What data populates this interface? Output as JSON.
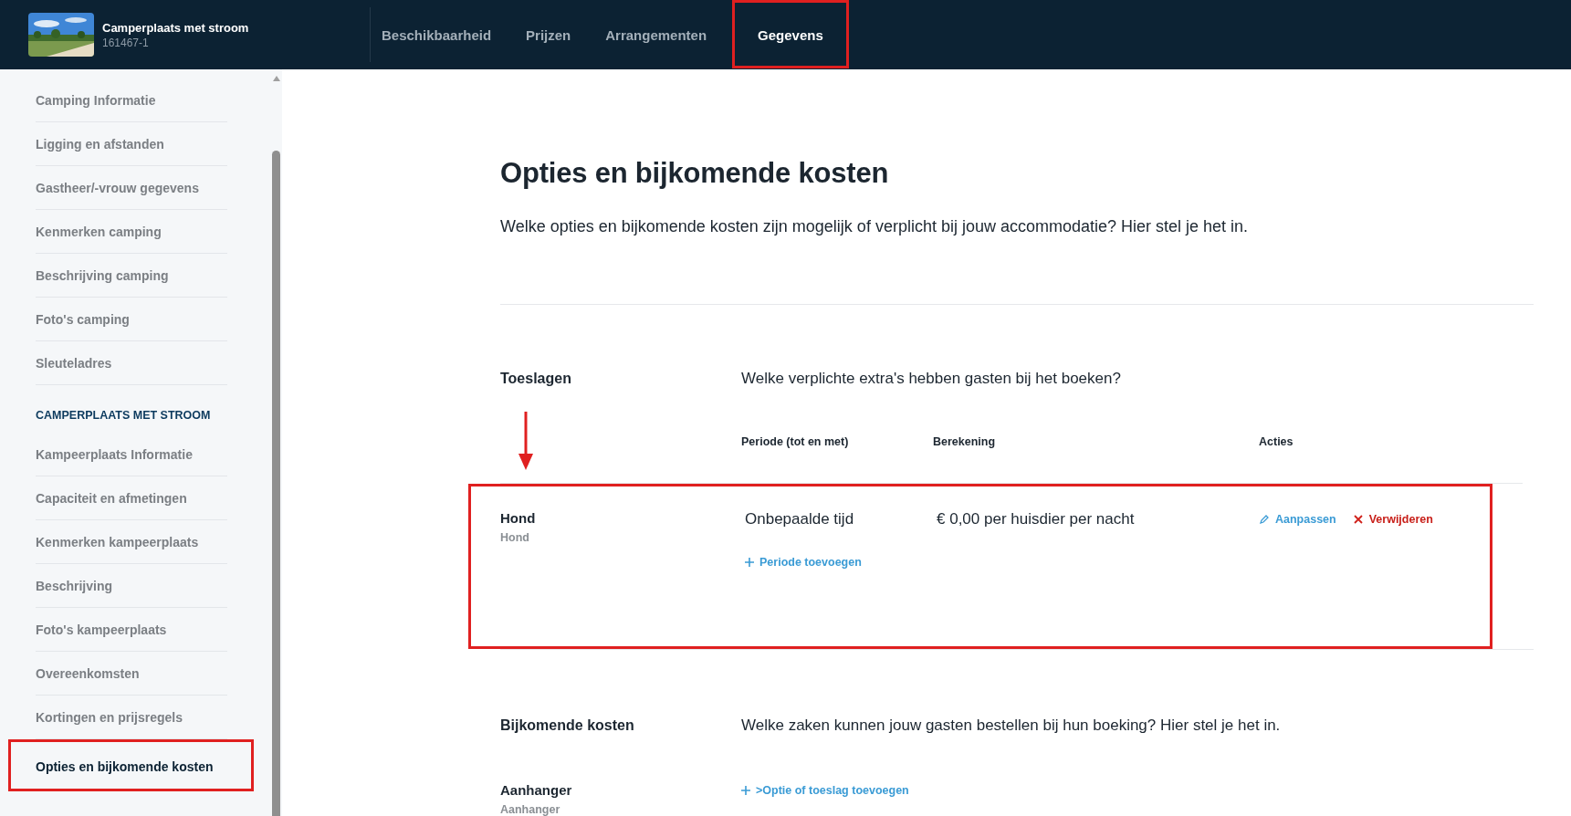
{
  "header": {
    "title": "Camperplaats met stroom",
    "code": "161467-1"
  },
  "tabs": [
    {
      "label": "Beschikbaarheid",
      "selected": false,
      "highlighted": false
    },
    {
      "label": "Prijzen",
      "selected": false,
      "highlighted": false
    },
    {
      "label": "Arrangementen",
      "selected": false,
      "highlighted": false
    },
    {
      "label": "Gegevens",
      "selected": true,
      "highlighted": true
    }
  ],
  "sidebar": {
    "items": [
      {
        "kind": "link",
        "label": "Camping Informatie",
        "selected": false,
        "highlighted": false
      },
      {
        "kind": "link",
        "label": "Ligging en afstanden",
        "selected": false,
        "highlighted": false
      },
      {
        "kind": "link",
        "label": "Gastheer/-vrouw gegevens",
        "selected": false,
        "highlighted": false
      },
      {
        "kind": "link",
        "label": "Kenmerken camping",
        "selected": false,
        "highlighted": false
      },
      {
        "kind": "link",
        "label": "Beschrijving camping",
        "selected": false,
        "highlighted": false
      },
      {
        "kind": "link",
        "label": "Foto's camping",
        "selected": false,
        "highlighted": false
      },
      {
        "kind": "link",
        "label": "Sleuteladres",
        "selected": false,
        "highlighted": false
      },
      {
        "kind": "heading",
        "label": "CAMPERPLAATS MET STROOM"
      },
      {
        "kind": "link",
        "label": "Kampeerplaats Informatie",
        "selected": false,
        "highlighted": false
      },
      {
        "kind": "link",
        "label": "Capaciteit en afmetingen",
        "selected": false,
        "highlighted": false
      },
      {
        "kind": "link",
        "label": "Kenmerken kampeerplaats",
        "selected": false,
        "highlighted": false
      },
      {
        "kind": "link",
        "label": "Beschrijving",
        "selected": false,
        "highlighted": false
      },
      {
        "kind": "link",
        "label": "Foto's kampeerplaats",
        "selected": false,
        "highlighted": false
      },
      {
        "kind": "link",
        "label": "Overeenkomsten",
        "selected": false,
        "highlighted": false
      },
      {
        "kind": "link",
        "label": "Kortingen en prijsregels",
        "selected": false,
        "highlighted": false
      },
      {
        "kind": "link",
        "label": "Opties en bijkomende kosten",
        "selected": true,
        "highlighted": true
      }
    ]
  },
  "page": {
    "title": "Opties en bijkomende kosten",
    "description": "Welke opties en bijkomende kosten zijn mogelijk of verplicht bij jouw accommodatie? Hier stel je het in."
  },
  "surcharges": {
    "title": "Toeslagen",
    "question": "Welke verplichte extra's hebben gasten bij het boeken?",
    "arrow": true,
    "columns": [
      "Periode (tot en met)",
      "Berekening",
      "Acties"
    ],
    "rows": [
      {
        "name": "Hond",
        "subtitle": "Hond",
        "period": "Onbepaalde tijd",
        "calculation": "€ 0,00 per huisdier per nacht",
        "edit": "Aanpassen",
        "delete": "Verwijderen",
        "add_period": "Periode toevoegen",
        "highlighted": true
      }
    ]
  },
  "extra_costs": {
    "title": "Bijkomende kosten",
    "question": "Welke zaken kunnen jouw gasten bestellen bij hun boeking? Hier stel je het in.",
    "rows": [
      {
        "name": "Aanhanger",
        "subtitle": "Aanhanger",
        "add": ">Optie of toeslag toevoegen"
      }
    ]
  }
}
